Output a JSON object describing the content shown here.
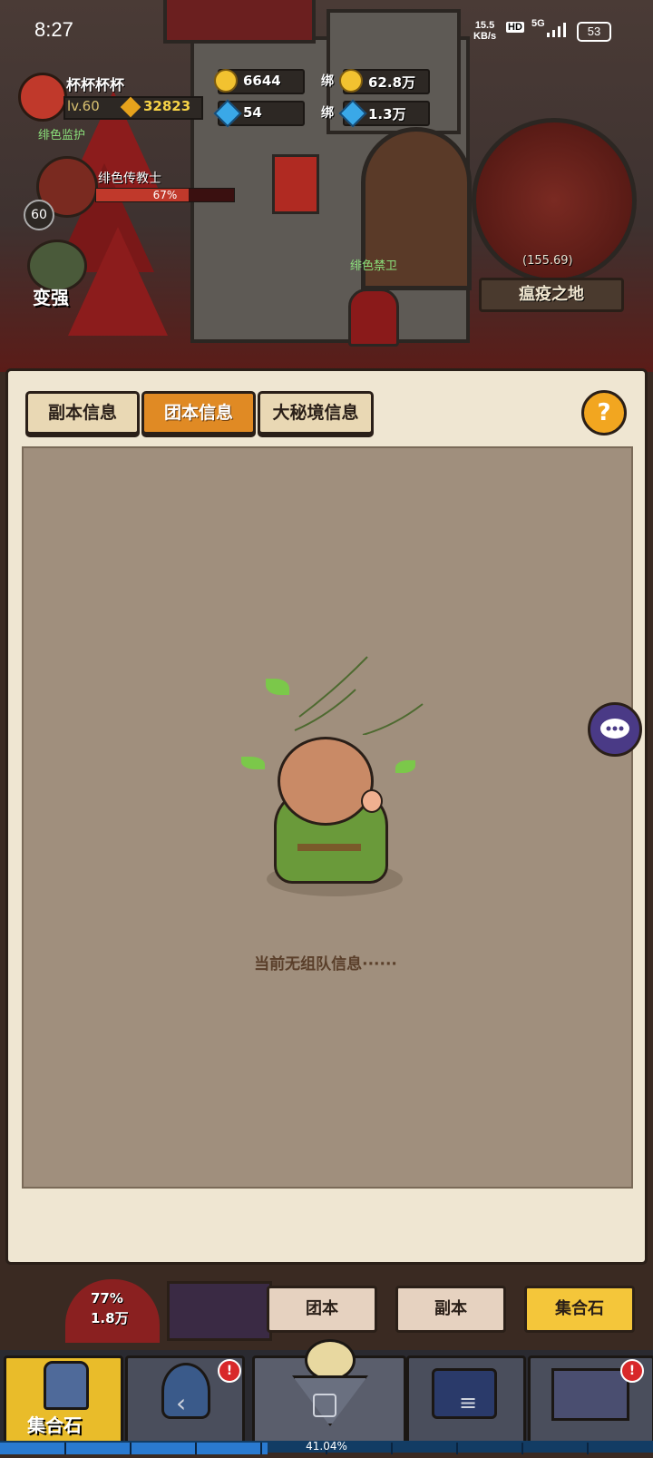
{
  "status_bar": {
    "time": "8:27",
    "net_speed_value": "15.5",
    "net_speed_unit": "KB/s",
    "hd": "HD",
    "network": "5G",
    "battery": "53"
  },
  "player": {
    "name": "杯杯杯杯",
    "level": "lv.60",
    "power": "32823"
  },
  "resources": {
    "gold": "6644",
    "diamond": "54",
    "bound_label": "绑",
    "bound_gold": "62.8万",
    "bound_diamond": "1.3万"
  },
  "side": {
    "label_top": "绯色监护",
    "npc_name": "绯色传教士",
    "npc_hp_pct": "67%",
    "npc_hp_fraction": 0.67,
    "npc_level": "60",
    "strengthen": "变强"
  },
  "map": {
    "coords": "(155.69)",
    "name": "瘟疫之地",
    "guard_label": "绯色禁卫"
  },
  "panel": {
    "tabs": [
      "副本信息",
      "团本信息",
      "大秘境信息"
    ],
    "active_tab": 1,
    "help": "?",
    "empty_message": "当前无组队信息······"
  },
  "bottom": {
    "hp_pct": "77%",
    "hp_value": "1.8万",
    "sub_buttons": [
      "团本",
      "副本",
      "集合石"
    ],
    "nav_active_label": "集合石",
    "xp_pct": "41.04%",
    "badge_mark": "!"
  },
  "icons": {
    "help": "question-icon",
    "chat": "chat-bubble-icon",
    "gold": "gold-coin-icon",
    "diamond": "diamond-icon"
  },
  "colors": {
    "accent": "#e08a24",
    "highlight": "#f4c63a",
    "panel_bg": "#efe6d2",
    "content_bg": "#a08f7d"
  }
}
